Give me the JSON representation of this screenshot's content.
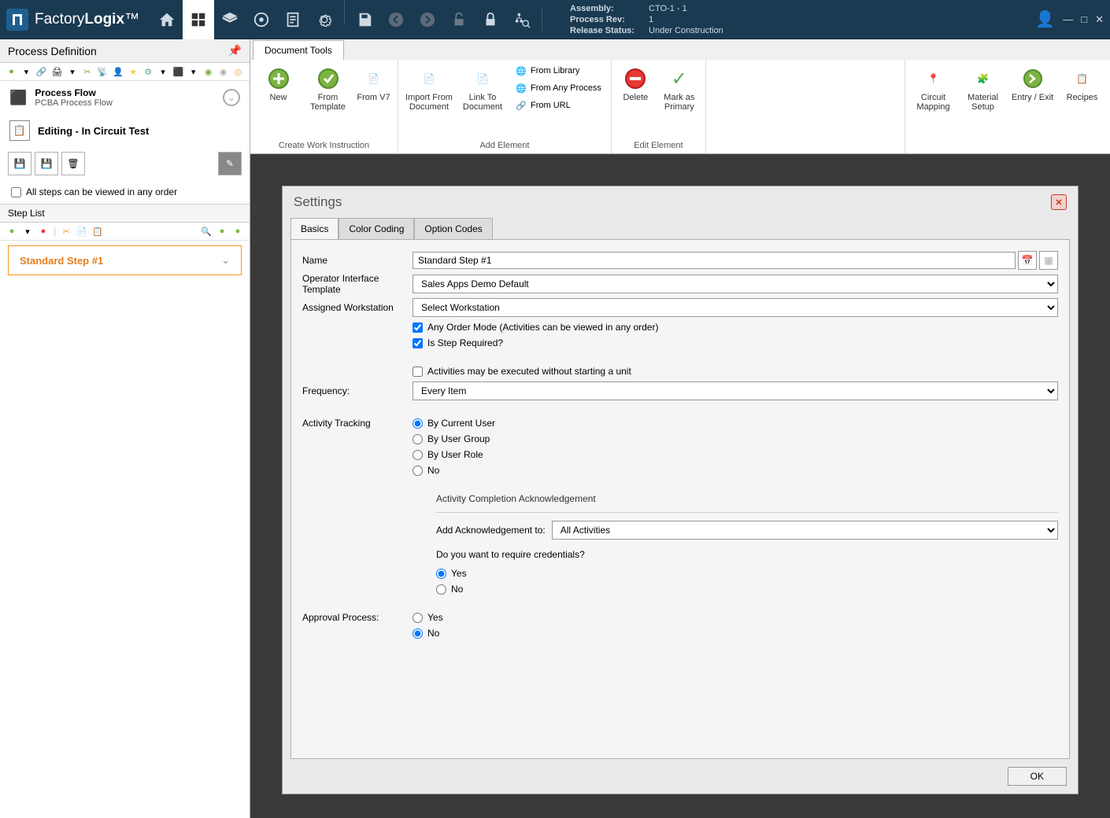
{
  "app": {
    "name": "FactoryLogix"
  },
  "assembly": {
    "label_assembly": "Assembly:",
    "assembly": "CTO-1 - 1",
    "label_rev": "Process Rev:",
    "rev": "1",
    "label_status": "Release Status:",
    "status": "Under Construction"
  },
  "leftPanel": {
    "title": "Process Definition",
    "processFlow": {
      "title": "Process Flow",
      "sub": "PCBA Process Flow"
    },
    "editing": "Editing - In Circuit Test",
    "anyOrderCheckbox": "All steps can be viewed in any order",
    "stepListHeader": "Step List",
    "step1": "Standard Step #1"
  },
  "ribbon": {
    "tab": "Document Tools",
    "newBtn": "New",
    "fromTemplate": "From Template",
    "fromV7": "From V7",
    "importFromDoc": "Import From Document",
    "linkToDoc": "Link To Document",
    "fromLibrary": "From Library",
    "fromAnyProcess": "From Any Process",
    "fromURL": "From URL",
    "delete": "Delete",
    "markPrimary": "Mark as Primary",
    "group1": "Create Work Instruction",
    "group2": "Add Element",
    "group3": "Edit Element",
    "circuitMapping": "Circuit Mapping",
    "materialSetup": "Material Setup",
    "entryExit": "Entry / Exit",
    "recipes": "Recipes"
  },
  "settings": {
    "title": "Settings",
    "tabs": {
      "basics": "Basics",
      "colorCoding": "Color Coding",
      "optionCodes": "Option Codes"
    },
    "nameLabel": "Name",
    "nameValue": "Standard Step #1",
    "opTemplateLabel": "Operator Interface Template",
    "opTemplateValue": "Sales Apps Demo Default",
    "workstationLabel": "Assigned Workstation",
    "workstationValue": "Select Workstation",
    "anyOrderMode": "Any Order Mode (Activities can be viewed in any order)",
    "isStepRequired": "Is Step Required?",
    "withoutUnit": "Activities may be executed without starting a unit",
    "frequencyLabel": "Frequency:",
    "frequencyValue": "Every Item",
    "activityTracking": "Activity Tracking",
    "byCurrentUser": "By Current User",
    "byUserGroup": "By User Group",
    "byUserRole": "By User Role",
    "no": "No",
    "yes": "Yes",
    "ackTitle": "Activity Completion Acknowledgement",
    "ackLabel": "Add Acknowledgement to:",
    "ackValue": "All Activities",
    "credentialsQ": "Do you want to require credentials?",
    "approvalLabel": "Approval Process:",
    "okBtn": "OK"
  }
}
